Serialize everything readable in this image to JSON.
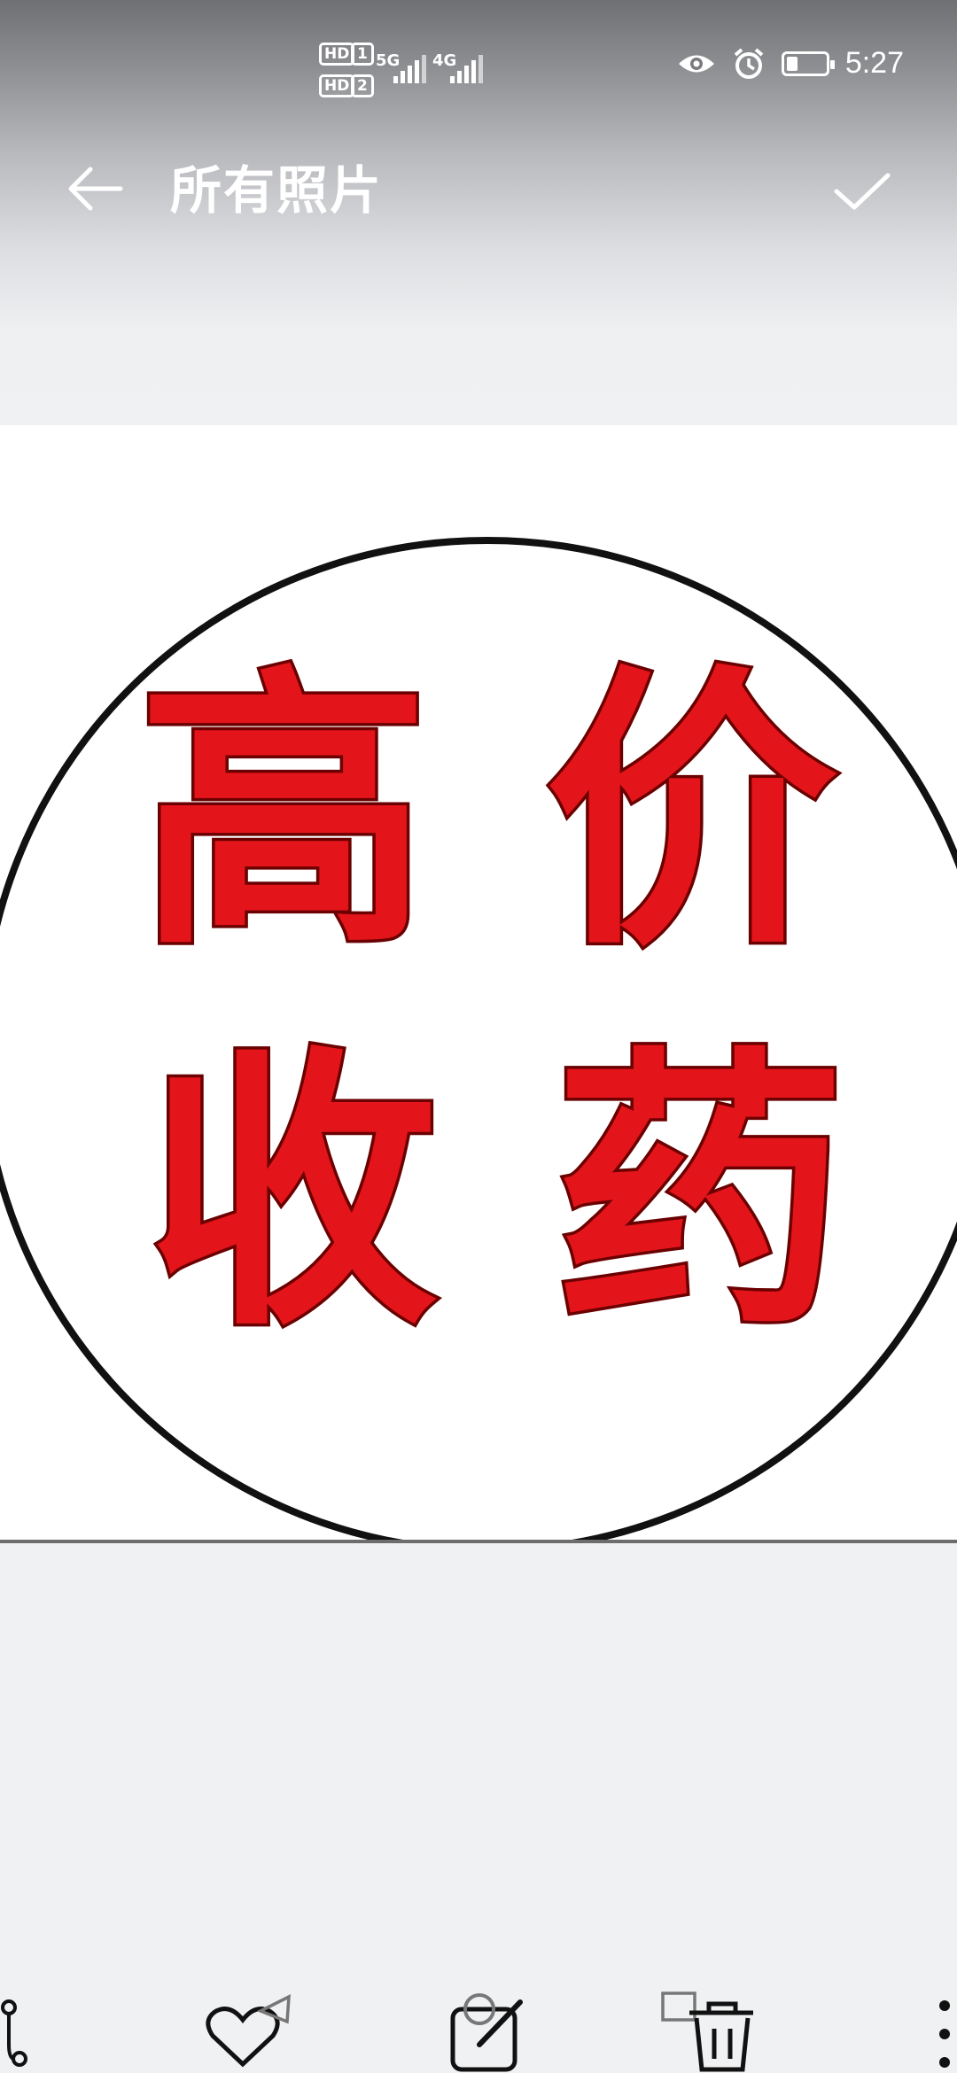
{
  "status_bar": {
    "time": "5:27",
    "sim1_tag": "HD",
    "sim1_index": "1",
    "sim2_tag": "HD",
    "sim2_index": "2",
    "network1": "5G",
    "network2": "4G",
    "battery_level": 0.25,
    "icons": [
      "eye-icon",
      "alarm-icon",
      "battery-icon"
    ]
  },
  "header": {
    "title": "所有照片",
    "back_icon": "arrow-left-icon",
    "confirm_icon": "checkmark-icon"
  },
  "photo": {
    "characters": [
      "高",
      "价",
      "收",
      "药"
    ],
    "text_color": "#e4141b",
    "circle_color": "#111111"
  },
  "toolbar": {
    "icons": [
      "share-icon",
      "favorite-icon",
      "edit-icon",
      "delete-icon",
      "more-icon"
    ]
  }
}
